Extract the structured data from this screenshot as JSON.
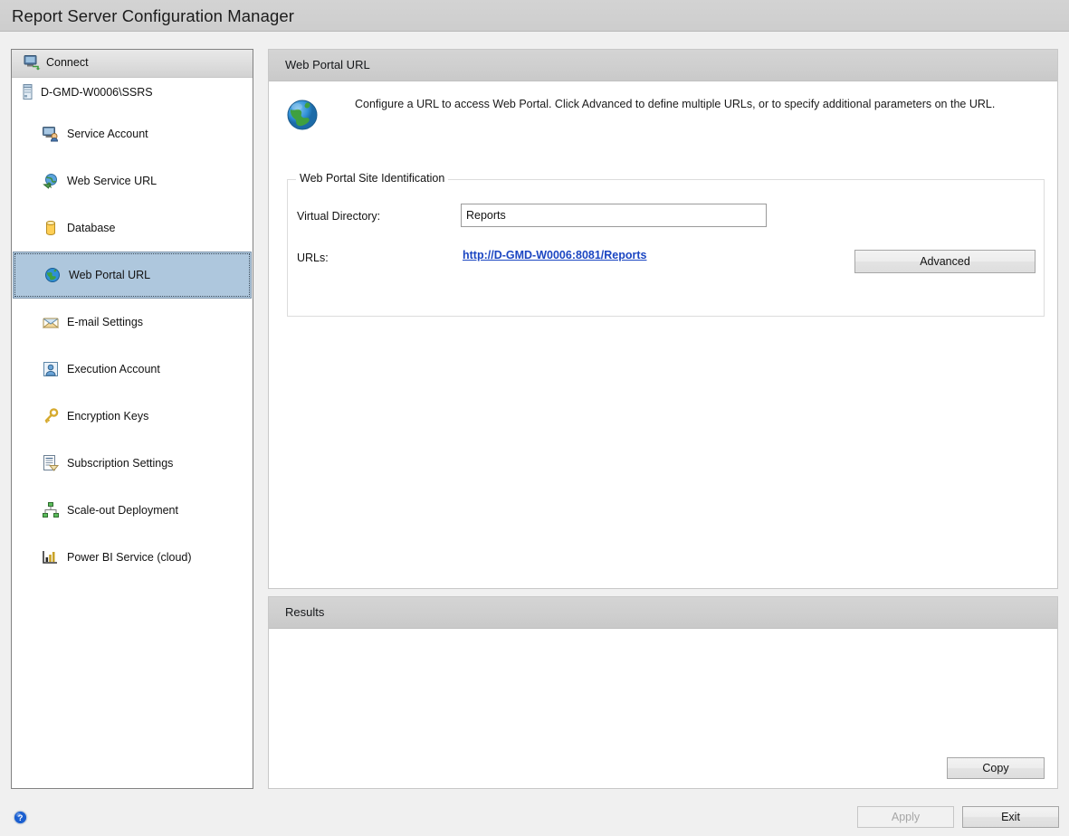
{
  "window": {
    "title": "Report Server Configuration Manager"
  },
  "sidebar": {
    "connect_label": "Connect",
    "connect_icon": "connect-server-icon",
    "server_node": {
      "label": "D-GMD-W0006\\SSRS",
      "icon": "server-icon"
    },
    "items": [
      {
        "label": "Service Account",
        "icon": "service-account-icon",
        "selected": false
      },
      {
        "label": "Web Service URL",
        "icon": "web-service-url-icon",
        "selected": false
      },
      {
        "label": "Database",
        "icon": "database-icon",
        "selected": false
      },
      {
        "label": "Web Portal URL",
        "icon": "globe-icon",
        "selected": true
      },
      {
        "label": "E-mail Settings",
        "icon": "email-icon",
        "selected": false
      },
      {
        "label": "Execution Account",
        "icon": "execution-account-icon",
        "selected": false
      },
      {
        "label": "Encryption Keys",
        "icon": "key-icon",
        "selected": false
      },
      {
        "label": "Subscription Settings",
        "icon": "subscription-icon",
        "selected": false
      },
      {
        "label": "Scale-out Deployment",
        "icon": "scale-out-icon",
        "selected": false
      },
      {
        "label": "Power BI Service (cloud)",
        "icon": "power-bi-icon",
        "selected": false
      }
    ]
  },
  "main": {
    "header_title": "Web Portal URL",
    "description_icon": "globe-icon",
    "description": "Configure a URL to access Web Portal.  Click Advanced to define multiple URLs, or to specify additional parameters on the URL.",
    "group": {
      "legend": "Web Portal Site Identification",
      "virtual_directory_label": "Virtual Directory:",
      "virtual_directory_value": "Reports",
      "urls_label": "URLs:",
      "url_value": "http://D-GMD-W0006:8081/Reports",
      "advanced_button": "Advanced"
    }
  },
  "results": {
    "header_title": "Results",
    "body_text": "",
    "copy_button": "Copy"
  },
  "footer": {
    "help_icon": "help-icon",
    "apply_button": "Apply",
    "apply_disabled": true,
    "exit_button": "Exit"
  },
  "colors": {
    "selection_blue": "#aec7dd",
    "link_blue": "#1b46c2",
    "titlebar_grey": "#d0d0d0",
    "panel_header_grey": "#cfcfcf",
    "window_bg": "#f0f0f0"
  }
}
